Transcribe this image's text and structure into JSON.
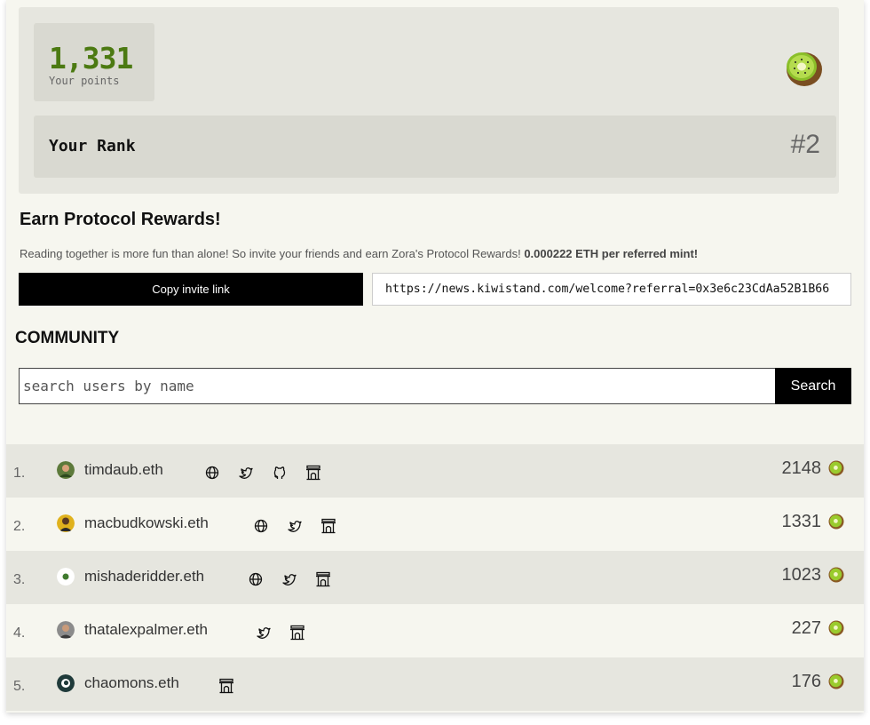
{
  "points": {
    "value": "1,331",
    "label": "Your points"
  },
  "rank": {
    "label": "Your Rank",
    "value": "#2"
  },
  "earn": {
    "title": "Earn Protocol Rewards!",
    "description": "Reading together is more fun than alone! So invite your friends and earn Zora's Protocol Rewards!",
    "highlight": "0.000222 ETH per referred mint!",
    "copy_button": "Copy invite link",
    "invite_link": "https://news.kiwistand.com/welcome?referral=0x3e6c23CdAa52B1B66"
  },
  "community": {
    "title": "COMMUNITY",
    "search_placeholder": "search users by name",
    "search_button": "Search"
  },
  "leaderboard": [
    {
      "rank": "1.",
      "name": "timdaub.eth",
      "score": "2148",
      "icons": [
        "globe-icon",
        "twitter-icon",
        "github-icon",
        "farcaster-icon"
      ]
    },
    {
      "rank": "2.",
      "name": "macbudkowski.eth",
      "score": "1331",
      "icons": [
        "globe-icon",
        "twitter-icon",
        "farcaster-icon"
      ]
    },
    {
      "rank": "3.",
      "name": "mishaderidder.eth",
      "score": "1023",
      "icons": [
        "globe-icon",
        "twitter-icon",
        "farcaster-icon"
      ]
    },
    {
      "rank": "4.",
      "name": "thatalexpalmer.eth",
      "score": "227",
      "icons": [
        "twitter-icon",
        "farcaster-icon"
      ]
    },
    {
      "rank": "5.",
      "name": "chaomons.eth",
      "score": "176",
      "icons": [
        "farcaster-icon"
      ]
    }
  ],
  "colors": {
    "accent_green": "#4c7a12",
    "panel": "#e6e6df",
    "box": "#d9d9d1",
    "background": "#f6f6ef"
  }
}
